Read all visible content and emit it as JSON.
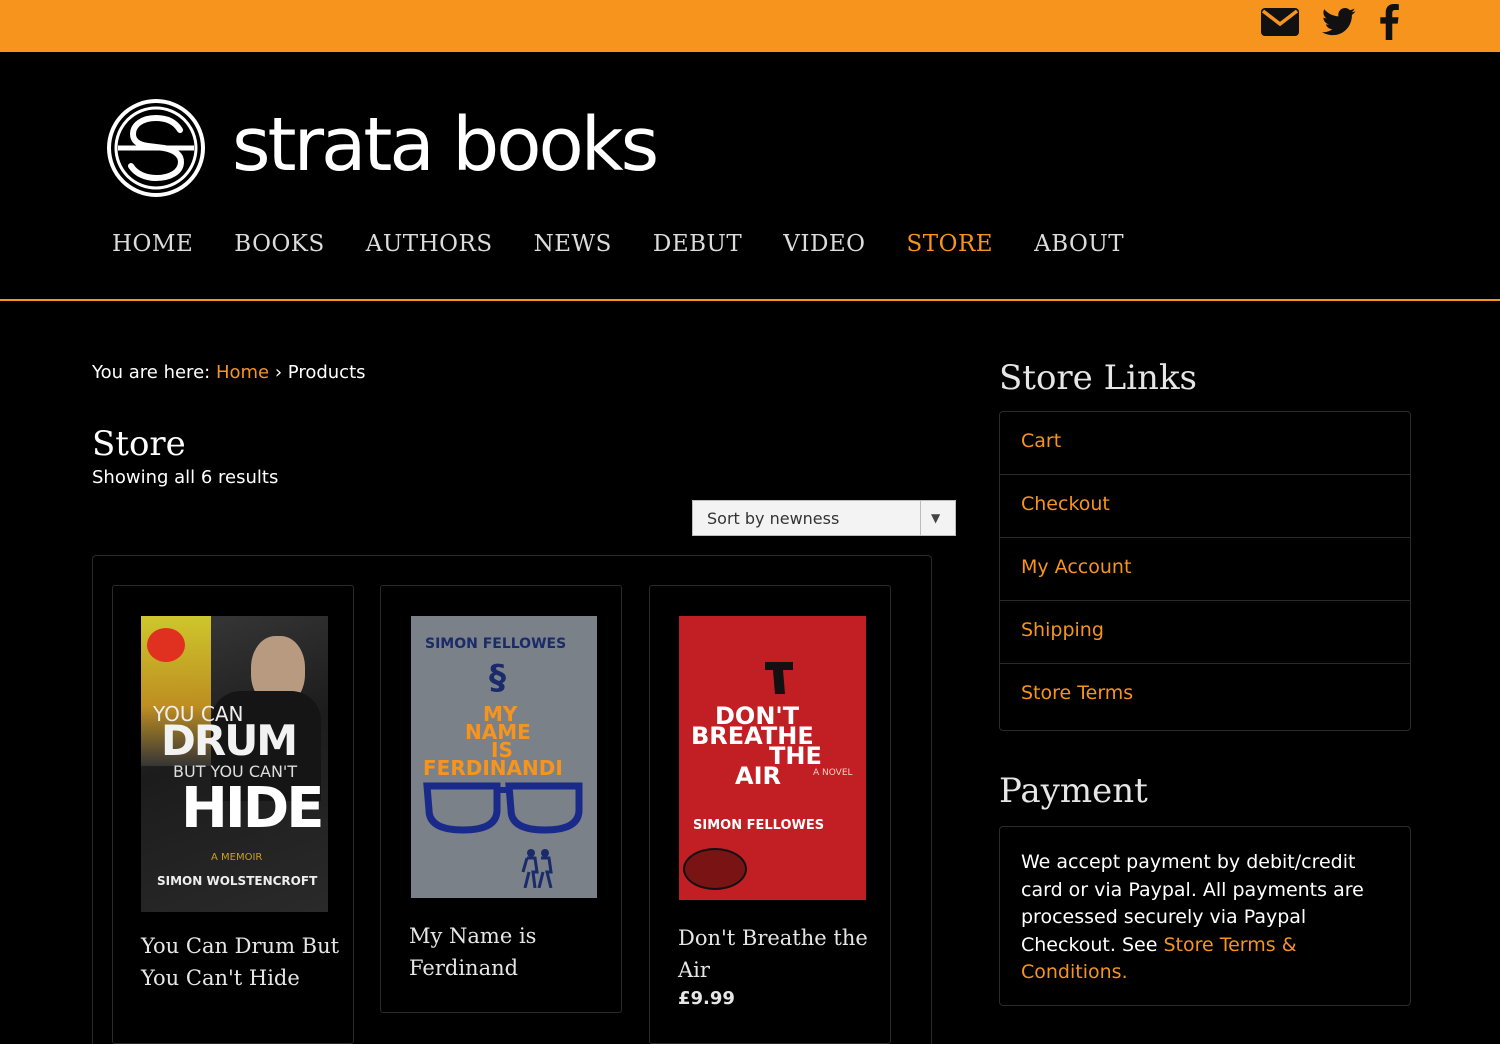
{
  "colors": {
    "accent": "#f7941d",
    "background": "#000000",
    "text": "#ffffff"
  },
  "social": [
    {
      "name": "envelope-icon"
    },
    {
      "name": "twitter-icon"
    },
    {
      "name": "facebook-icon"
    }
  ],
  "brand": {
    "name": "strata books"
  },
  "nav": {
    "items": [
      "HOME",
      "BOOKS",
      "AUTHORS",
      "NEWS",
      "DEBUT",
      "VIDEO",
      "STORE",
      "ABOUT"
    ],
    "active": "STORE"
  },
  "breadcrumb": {
    "prefix": "You are here:",
    "home": "Home",
    "separator": "›",
    "current": "Products"
  },
  "store": {
    "title": "Store",
    "results": "Showing all 6 results",
    "sort": {
      "selected": "Sort by newness"
    }
  },
  "products": [
    {
      "title": "You Can Drum But You Can't Hide",
      "price": "",
      "cover": {
        "line1": "YOU CAN",
        "line2": "DRUM",
        "line3": "BUT YOU CAN'T",
        "line4": "HIDE",
        "sub": "A MEMOIR",
        "author": "SIMON WOLSTENCROFT"
      }
    },
    {
      "title": "My Name is Ferdinand",
      "price": "",
      "cover": {
        "author": "SIMON FELLOWES",
        "line1": "MY",
        "line2": "NAME",
        "line3": "IS",
        "line4": "FERDINANDI"
      }
    },
    {
      "title": "Don't Breathe the Air",
      "price": "£9.99",
      "cover": {
        "line1": "DON'T",
        "line2": "BREATHE",
        "line3": "THE",
        "line4": "AIR",
        "sub": "A NOVEL",
        "author": "SIMON FELLOWES"
      }
    }
  ],
  "sidebar": {
    "store_links_title": "Store Links",
    "store_links": [
      "Cart",
      "Checkout",
      "My Account",
      "Shipping",
      "Store Terms"
    ],
    "payment_title": "Payment",
    "payment_text": "We accept payment by debit/credit card or via Paypal. All payments are processed securely via Paypal Checkout. See ",
    "payment_link": "Store Terms & Conditions."
  }
}
